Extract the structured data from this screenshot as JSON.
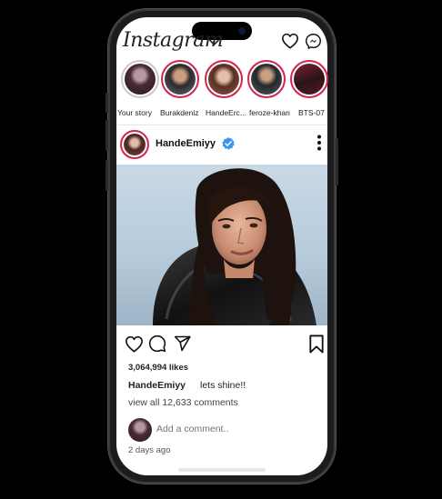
{
  "app": {
    "name": "Instagram"
  },
  "header": {
    "logo": "Instagram",
    "icons": [
      "heart-icon",
      "messenger-icon"
    ]
  },
  "stories": [
    {
      "label": "Your story",
      "own": true
    },
    {
      "label": "Burakdeniz"
    },
    {
      "label": "HandeErc..."
    },
    {
      "label": "feroze-khan"
    },
    {
      "label": "BTS-07"
    }
  ],
  "post": {
    "username": "HandeEmiyy",
    "verified": true,
    "likes": "3,064,994 likes",
    "caption_user": "HandeEmiyy",
    "caption_text": "lets shine!!",
    "view_comments": "view all 12,633 comments",
    "comment_placeholder": "Add a comment..",
    "time_ago": "2 days ago"
  },
  "colors": {
    "story_ring": "#d6224e",
    "verified": "#3897f0",
    "background": "#000000"
  }
}
